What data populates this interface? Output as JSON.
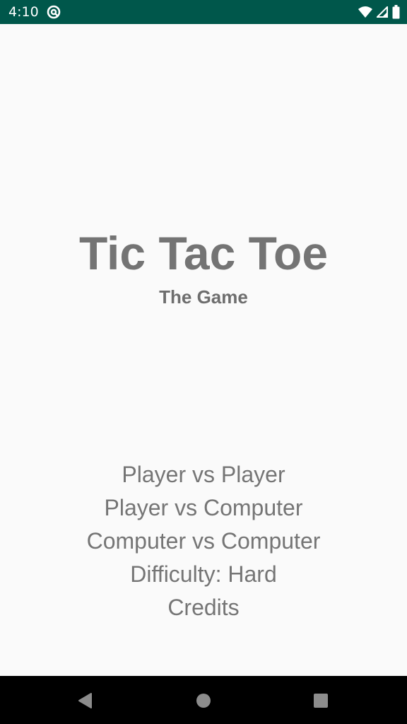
{
  "status_bar": {
    "time": "4:10",
    "app_icon": "at-sign-icon",
    "wifi_icon": "wifi-icon",
    "signal_icon": "cell-signal-icon",
    "battery_icon": "battery-icon",
    "background_color": "#00574b"
  },
  "main": {
    "title": "Tic Tac Toe",
    "subtitle": "The Game"
  },
  "menu": {
    "items": [
      {
        "label": "Player vs Player"
      },
      {
        "label": "Player vs Computer"
      },
      {
        "label": "Computer vs Computer"
      },
      {
        "label": "Difficulty: Hard"
      },
      {
        "label": "Credits"
      }
    ]
  },
  "nav_bar": {
    "back_icon": "back-triangle-icon",
    "home_icon": "home-circle-icon",
    "recents_icon": "recents-square-icon"
  }
}
